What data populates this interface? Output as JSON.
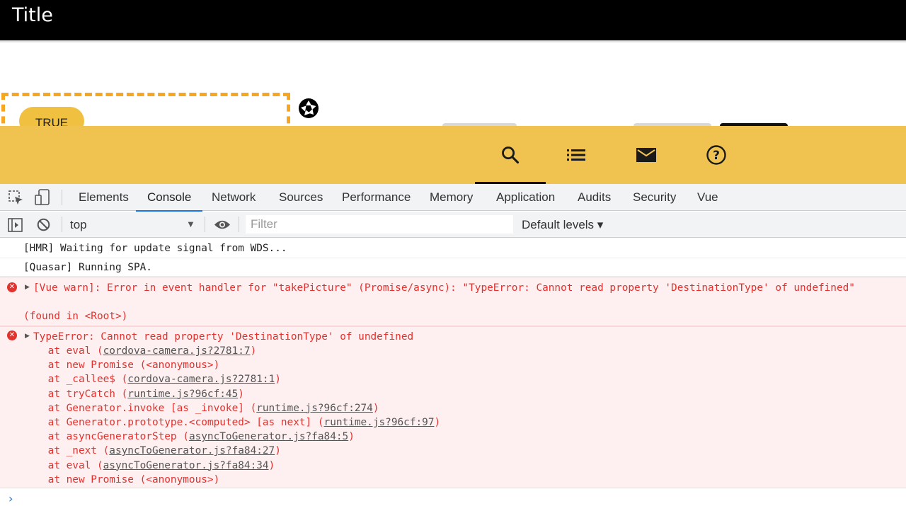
{
  "app": {
    "title": "Title",
    "chip_label": "TRUE"
  },
  "bottom_nav": {
    "items": [
      {
        "icon": "search-icon",
        "active": true
      },
      {
        "icon": "list-icon",
        "active": false
      },
      {
        "icon": "mail-icon",
        "active": false
      },
      {
        "icon": "help-icon",
        "active": false
      }
    ]
  },
  "devtools": {
    "tabs": [
      "Elements",
      "Console",
      "Network",
      "Sources",
      "Performance",
      "Memory",
      "Application",
      "Audits",
      "Security",
      "Vue"
    ],
    "active_tab": "Console",
    "toolbar": {
      "context": "top",
      "filter_placeholder": "Filter",
      "levels": "Default levels ▾"
    },
    "console": {
      "logs": [
        "[HMR] Waiting for update signal from WDS...",
        "[Quasar] Running SPA."
      ],
      "error1": {
        "message": "[Vue warn]: Error in event handler for \"takePicture\" (Promise/async): \"TypeError: Cannot read property 'DestinationType' of undefined\"",
        "found": "(found in <Root>)"
      },
      "error2": {
        "message": "TypeError: Cannot read property 'DestinationType' of undefined",
        "stack": [
          {
            "prefix": "    at eval (",
            "link": "cordova-camera.js?2781:7",
            "suffix": ")"
          },
          {
            "prefix": "    at new Promise (<anonymous>)",
            "link": "",
            "suffix": ""
          },
          {
            "prefix": "    at _callee$ (",
            "link": "cordova-camera.js?2781:1",
            "suffix": ")"
          },
          {
            "prefix": "    at tryCatch (",
            "link": "runtime.js?96cf:45",
            "suffix": ")"
          },
          {
            "prefix": "    at Generator.invoke [as _invoke] (",
            "link": "runtime.js?96cf:274",
            "suffix": ")"
          },
          {
            "prefix": "    at Generator.prototype.<computed> [as next] (",
            "link": "runtime.js?96cf:97",
            "suffix": ")"
          },
          {
            "prefix": "    at asyncGeneratorStep (",
            "link": "asyncToGenerator.js?fa84:5",
            "suffix": ")"
          },
          {
            "prefix": "    at _next (",
            "link": "asyncToGenerator.js?fa84:27",
            "suffix": ")"
          },
          {
            "prefix": "    at eval (",
            "link": "asyncToGenerator.js?fa84:34",
            "suffix": ")"
          },
          {
            "prefix": "    at new Promise (<anonymous>)",
            "link": "",
            "suffix": ""
          }
        ]
      },
      "prompt_symbol": "›"
    }
  }
}
